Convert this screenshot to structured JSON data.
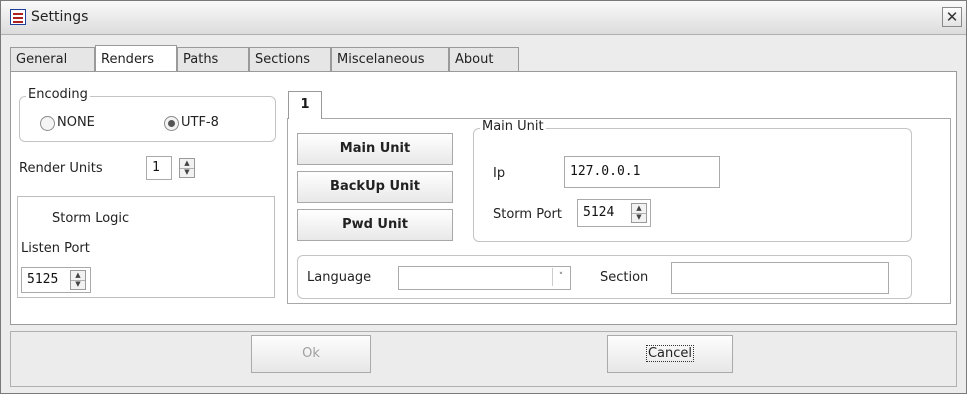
{
  "window": {
    "title": "Settings",
    "close_glyph": "✕"
  },
  "tabs": [
    {
      "label": "General"
    },
    {
      "label": "Renders",
      "active": true
    },
    {
      "label": "Paths"
    },
    {
      "label": "Sections"
    },
    {
      "label": "Miscelaneous"
    },
    {
      "label": "About"
    }
  ],
  "encoding": {
    "legend": "Encoding",
    "options": [
      {
        "label": "NONE",
        "selected": false
      },
      {
        "label": "UTF-8",
        "selected": true
      }
    ]
  },
  "render_units": {
    "label": "Render Units",
    "value": "1"
  },
  "storm_logic": {
    "title": "Storm Logic",
    "listen_port_label": "Listen Port",
    "listen_port_value": "5125"
  },
  "unit_tab": {
    "label": "1"
  },
  "unit_buttons": {
    "main": "Main Unit",
    "backup": "BackUp Unit",
    "pwd": "Pwd Unit"
  },
  "main_unit": {
    "legend": "Main Unit",
    "ip_label": "Ip",
    "ip_value": "127.0.0.1",
    "storm_port_label": "Storm Port",
    "storm_port_value": "5124"
  },
  "language": {
    "label": "Language",
    "value": ""
  },
  "section": {
    "label": "Section",
    "value": ""
  },
  "footer": {
    "ok_label": "Ok",
    "ok_disabled": true,
    "cancel_label": "Cancel"
  },
  "icons": {
    "app": "list-icon",
    "close": "close-icon",
    "spin_up": "spin-up-icon",
    "spin_down": "spin-down-icon",
    "dropdown": "chevron-down-icon"
  }
}
